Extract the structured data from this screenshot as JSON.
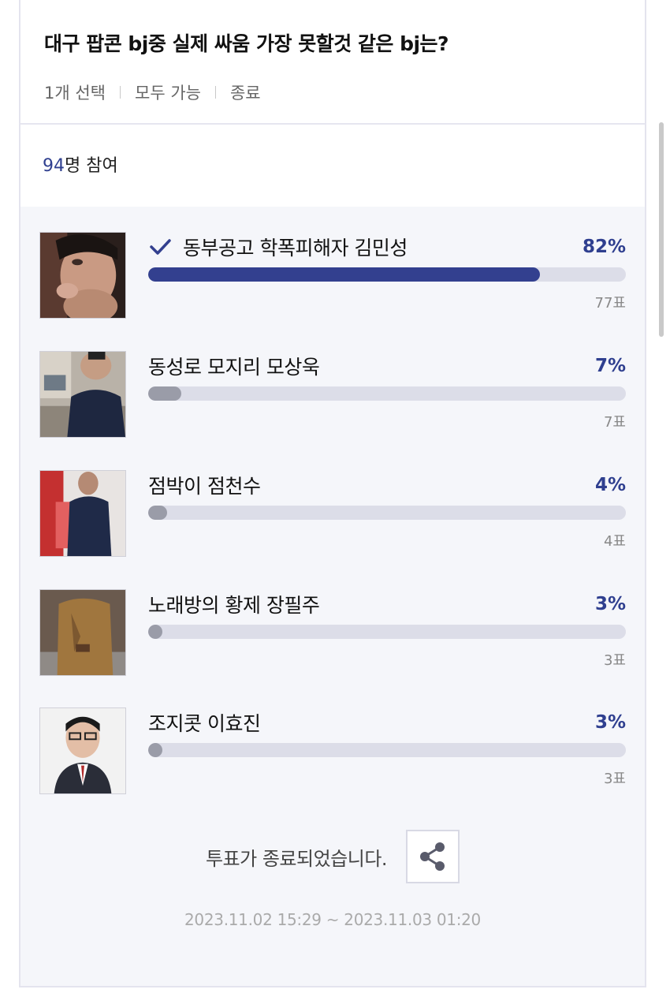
{
  "poll": {
    "title": "대구 팝콘 bj중 실제 싸움 가장 못할것 같은 bj는?",
    "meta": [
      "1개 선택",
      "모두 가능",
      "종료"
    ],
    "participants_count": "94",
    "participants_suffix": "명 참여"
  },
  "options": [
    {
      "label": "동부공고 학폭피해자 김민성",
      "percent_text": "82%",
      "percent": 82,
      "votes": "77표",
      "selected": true,
      "bar_color": "#33408f"
    },
    {
      "label": "동성로 모지리 모상욱",
      "percent_text": "7%",
      "percent": 7,
      "votes": "7표",
      "selected": false,
      "bar_color": "#9a9ca8"
    },
    {
      "label": "점박이 점천수",
      "percent_text": "4%",
      "percent": 4,
      "votes": "4표",
      "selected": false,
      "bar_color": "#9a9ca8"
    },
    {
      "label": "노래방의 황제 장필주",
      "percent_text": "3%",
      "percent": 3,
      "votes": "3표",
      "selected": false,
      "bar_color": "#9a9ca8"
    },
    {
      "label": "조지콧 이효진",
      "percent_text": "3%",
      "percent": 3,
      "votes": "3표",
      "selected": false,
      "bar_color": "#9a9ca8"
    }
  ],
  "footer": {
    "ended_text": "투표가 종료되었습니다.",
    "date_range": "2023.11.02 15:29 ~ 2023.11.03 01:20",
    "share_icon": "share-icon"
  },
  "colors": {
    "accent": "#2f3f8f",
    "bar_track": "#dcdde8"
  }
}
